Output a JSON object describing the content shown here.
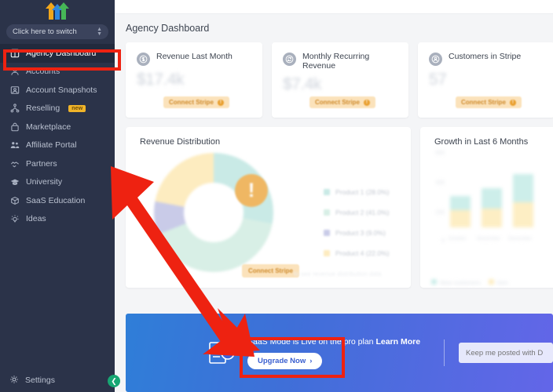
{
  "sidebar": {
    "logo_name": "three-arrows-logo",
    "switcher": {
      "label": "Click here to switch",
      "icon": "chevron-updown-icon"
    },
    "items": [
      {
        "label": "Agency Dashboard",
        "icon": "dashboard-icon",
        "active": true
      },
      {
        "label": "Accounts",
        "icon": "person-icon",
        "active": false
      },
      {
        "label": "Account Snapshots",
        "icon": "image-icon",
        "active": false
      },
      {
        "label": "Reselling",
        "icon": "hierarchy-icon",
        "active": false,
        "badge": "new"
      },
      {
        "label": "Marketplace",
        "icon": "bag-icon",
        "active": false
      },
      {
        "label": "Affiliate Portal",
        "icon": "people-icon",
        "active": false
      },
      {
        "label": "Partners",
        "icon": "handshake-icon",
        "active": false
      },
      {
        "label": "University",
        "icon": "graduation-cap-icon",
        "active": false
      },
      {
        "label": "SaaS Education",
        "icon": "cube-icon",
        "active": false
      },
      {
        "label": "Ideas",
        "icon": "lightbulb-icon",
        "active": false
      }
    ],
    "settings": {
      "label": "Settings",
      "icon": "gear-icon"
    },
    "collapse": {
      "icon": "chevron-left-icon"
    }
  },
  "header": {
    "title": "Agency Dashboard"
  },
  "stat_cards": [
    {
      "title": "Revenue Last Month",
      "value": "$17.4k",
      "icon": "dollar-circle-icon",
      "cta": "Connect Stripe"
    },
    {
      "title": "Monthly Recurring Revenue",
      "value": "$7.4k",
      "icon": "refresh-circle-icon",
      "cta": "Connect Stripe"
    },
    {
      "title": "Customers in Stripe",
      "value": "57",
      "icon": "user-circle-icon",
      "cta": "Connect Stripe"
    }
  ],
  "revenue_distribution": {
    "title": "Revenue Distribution",
    "cta": "Connect Stripe",
    "ghost_text": "to see revenue distribution data",
    "warning_icon": "exclamation-circle-icon"
  },
  "growth": {
    "title": "Growth in Last 6 Months"
  },
  "chart_data": [
    {
      "type": "pie",
      "title": "Revenue Distribution",
      "labels": [
        "Product 1 (28.0%)",
        "Product 2 (41.0%)",
        "Product 3 (9.0%)",
        "Product 4 (22.0%)"
      ],
      "values": [
        28.0,
        41.0,
        9.0,
        22.0
      ],
      "colors": [
        "#c9eae6",
        "#d8efe6",
        "#c9cbe8",
        "#fdecc0"
      ],
      "legend_position": "right",
      "donut": true
    },
    {
      "type": "bar",
      "title": "Growth in Last 6 Months",
      "categories": [
        "October",
        "November",
        "December"
      ],
      "series": [
        {
          "name": "New customers",
          "values": [
            90,
            130,
            180
          ],
          "color": "#cdeeea"
        },
        {
          "name": "Gen",
          "values": [
            110,
            120,
            160
          ],
          "color": "#fdeec4"
        }
      ],
      "ylabel": "",
      "xlabel": "",
      "yticks": [
        "600",
        "400",
        "200",
        "0"
      ],
      "ylim": [
        0,
        600
      ],
      "grid": false,
      "legend_position": "bottom"
    }
  ],
  "banner": {
    "icon": "report-chart-icon",
    "message_prefix": "SaaS Mode is Live on the pro plan ",
    "learn_more": "Learn More",
    "upgrade_label": "Upgrade Now",
    "upgrade_chevron": "›",
    "newsletter_placeholder": "Keep me posted with D"
  },
  "annotations": {
    "accent_red": "#ee2211",
    "box_sidebar": "agency-dashboard-nav-highlight",
    "box_upgrade": "upgrade-now-highlight",
    "arrow": "red-pointer-arrow"
  }
}
